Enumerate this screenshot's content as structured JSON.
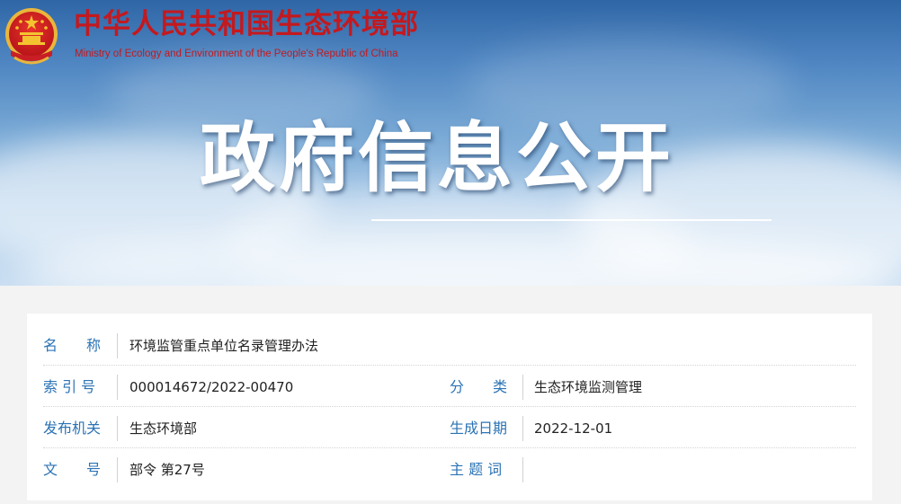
{
  "header": {
    "site_title_cn": "中华人民共和国生态环境部",
    "site_title_en": "Ministry of Ecology and Environment of the People's Republic of China",
    "banner_title": "政府信息公开"
  },
  "colors": {
    "brand_red": "#c3191f",
    "label_blue": "#2b73b5",
    "value_text": "#222222"
  },
  "icons": {
    "emblem": "national-emblem-icon"
  },
  "info": {
    "name": {
      "label": "名　　称",
      "value": "环境监管重点单位名录管理办法"
    },
    "index_no": {
      "label": "索 引 号",
      "value": "000014672/2022-00470"
    },
    "category": {
      "label": "分　　类",
      "value": "生态环境监测管理"
    },
    "issuer": {
      "label": "发布机关",
      "value": "生态环境部"
    },
    "date": {
      "label": "生成日期",
      "value": "2022-12-01"
    },
    "doc_no": {
      "label": "文　　号",
      "value": "部令 第27号"
    },
    "keywords": {
      "label": "主 题 词",
      "value": ""
    }
  }
}
